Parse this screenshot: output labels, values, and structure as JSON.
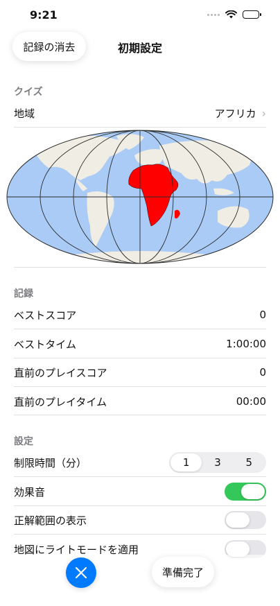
{
  "status": {
    "time": "9:21"
  },
  "nav": {
    "clear_label": "記録の消去",
    "title": "初期設定"
  },
  "quiz": {
    "header": "クイズ",
    "region_label": "地域",
    "region_value": "アフリカ",
    "map_highlight_color": "#ff0000",
    "map_ocean_color": "#a9cbf5",
    "map_land_color": "#f0ede4"
  },
  "records": {
    "header": "記録",
    "rows": [
      {
        "label": "ベストスコア",
        "value": "0"
      },
      {
        "label": "ベストタイム",
        "value": "1:00:00"
      },
      {
        "label": "直前のプレイスコア",
        "value": "0"
      },
      {
        "label": "直前のプレイタイム",
        "value": "00:00"
      }
    ]
  },
  "settings": {
    "header": "設定",
    "time_limit_label": "制限時間（分）",
    "time_limit_options": [
      "1",
      "3",
      "5"
    ],
    "time_limit_selected": "1",
    "sound_label": "効果音",
    "sound_on": true,
    "show_range_label": "正解範囲の表示",
    "show_range_on": false,
    "light_mode_label": "地図にライトモードを適用",
    "light_mode_on": false
  },
  "colors": {
    "accent": "#007aff",
    "toggle_on": "#34c759",
    "toggle_off": "#e5e5ea"
  },
  "footer": {
    "done_label": "準備完了",
    "close_icon": "close-icon"
  }
}
